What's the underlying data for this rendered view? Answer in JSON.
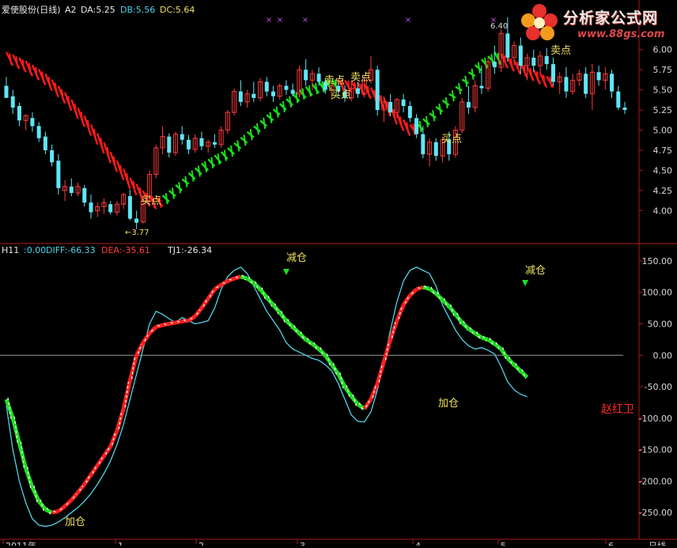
{
  "top_panel": {
    "name": "爱使股份(日线)",
    "tag": "A2",
    "readouts": [
      {
        "text": "DA:5.25",
        "color": "#e8e8e8"
      },
      {
        "text": "DB:5.56",
        "color": "#4fd4e8"
      },
      {
        "text": "DC:5.64",
        "color": "#f0e060"
      }
    ]
  },
  "bottom_panel": {
    "name": "H11",
    "readouts": [
      {
        "text": ":0.00",
        "color": "#4fd4e8"
      },
      {
        "text": "DIFF:-66.33",
        "color": "#4fd4e8"
      },
      {
        "text": "DEA:-35.61",
        "color": "#ff4040"
      },
      {
        "text": "TJ1:-26.34",
        "color": "#e8e8e8"
      }
    ]
  },
  "logo": {
    "title": "分析家公式网",
    "url": "www.88gs.com"
  },
  "x_axis": {
    "labels": [
      "2011年",
      "1",
      "2",
      "3",
      "4",
      "5",
      "6"
    ],
    "right_label": "日线"
  },
  "colors": {
    "up_candle": "#ff3b3b",
    "down_candle": "#5fe6f6",
    "ribbon_up": "#18e018",
    "ribbon_down": "#ff1a1a",
    "diff_line": "#4fd4e8",
    "dea_line": "#ff2020",
    "axis": "#b01818",
    "label": "#f0e060"
  },
  "chart_data": [
    {
      "type": "candlestick",
      "y_axis": {
        "ticks": [
          4.0,
          4.25,
          4.5,
          4.75,
          5.0,
          5.25,
          5.5,
          5.75,
          6.0
        ],
        "ylim": [
          3.65,
          6.4
        ]
      },
      "annotations": [
        {
          "text": "←3.77",
          "kind": "low_marker",
          "value": 3.77
        },
        {
          "text": "6.40",
          "kind": "high_marker",
          "value": 6.4
        },
        {
          "text": "买点",
          "kind": "buy"
        },
        {
          "text": "卖点",
          "kind": "sell"
        },
        {
          "text": "卖点",
          "kind": "sell"
        },
        {
          "text": "买点",
          "kind": "buy"
        },
        {
          "text": "买点",
          "kind": "buy"
        },
        {
          "text": "卖点",
          "kind": "sell"
        }
      ],
      "markers": [
        "×",
        "×",
        "×",
        "×",
        "×"
      ],
      "ribbon_values": [
        5.9,
        5.87,
        5.83,
        5.79,
        5.74,
        5.69,
        5.63,
        5.56,
        5.48,
        5.4,
        5.31,
        5.21,
        5.11,
        5.0,
        4.89,
        4.78,
        4.66,
        4.55,
        4.45,
        4.34,
        4.26,
        4.18,
        4.12,
        4.09,
        4.12,
        4.18,
        4.25,
        4.32,
        4.4,
        4.46,
        4.52,
        4.57,
        4.62,
        4.66,
        4.71,
        4.77,
        4.84,
        4.91,
        4.98,
        5.05,
        5.12,
        5.19,
        5.26,
        5.32,
        5.38,
        5.43,
        5.47,
        5.5,
        5.53,
        5.55,
        5.56,
        5.56,
        5.55,
        5.54,
        5.52,
        5.5,
        5.46,
        5.4,
        5.33,
        5.24,
        5.14,
        5.06,
        5.0,
        5.02,
        5.07,
        5.14,
        5.22,
        5.3,
        5.38,
        5.47,
        5.56,
        5.65,
        5.74,
        5.81,
        5.85,
        5.9,
        5.88,
        5.84,
        5.8,
        5.76,
        5.72,
        5.68,
        5.64,
        5.6
      ],
      "ribbon_states": [
        "down",
        "down",
        "down",
        "down",
        "down",
        "down",
        "down",
        "down",
        "down",
        "down",
        "down",
        "down",
        "down",
        "down",
        "down",
        "down",
        "down",
        "down",
        "down",
        "down",
        "down",
        "down",
        "down",
        "down",
        "up",
        "up",
        "up",
        "up",
        "up",
        "up",
        "up",
        "up",
        "up",
        "up",
        "up",
        "up",
        "up",
        "up",
        "up",
        "up",
        "up",
        "up",
        "up",
        "up",
        "up",
        "up",
        "up",
        "up",
        "up",
        "up",
        "up",
        "down",
        "down",
        "down",
        "down",
        "down",
        "down",
        "down",
        "down",
        "down",
        "down",
        "down",
        "down",
        "up",
        "up",
        "up",
        "up",
        "up",
        "up",
        "up",
        "up",
        "up",
        "up",
        "up",
        "up",
        "up",
        "down",
        "down",
        "down",
        "down",
        "down",
        "down",
        "down",
        "down"
      ],
      "candles": [
        {
          "o": 5.55,
          "h": 5.66,
          "l": 5.45,
          "c": 5.4
        },
        {
          "o": 5.42,
          "h": 5.5,
          "l": 5.2,
          "c": 5.28
        },
        {
          "o": 5.3,
          "h": 5.34,
          "l": 5.05,
          "c": 5.12
        },
        {
          "o": 5.12,
          "h": 5.2,
          "l": 5.0,
          "c": 5.18
        },
        {
          "o": 5.15,
          "h": 5.22,
          "l": 4.98,
          "c": 5.05
        },
        {
          "o": 5.05,
          "h": 5.1,
          "l": 4.85,
          "c": 4.9
        },
        {
          "o": 4.92,
          "h": 4.98,
          "l": 4.7,
          "c": 4.75
        },
        {
          "o": 4.75,
          "h": 4.82,
          "l": 4.55,
          "c": 4.6
        },
        {
          "o": 4.62,
          "h": 4.7,
          "l": 4.2,
          "c": 4.28
        },
        {
          "o": 4.25,
          "h": 4.38,
          "l": 4.12,
          "c": 4.3
        },
        {
          "o": 4.3,
          "h": 4.4,
          "l": 4.18,
          "c": 4.22
        },
        {
          "o": 4.22,
          "h": 4.35,
          "l": 4.18,
          "c": 4.3
        },
        {
          "o": 4.28,
          "h": 4.32,
          "l": 4.05,
          "c": 4.1
        },
        {
          "o": 4.1,
          "h": 4.2,
          "l": 3.9,
          "c": 3.98
        },
        {
          "o": 4.0,
          "h": 4.1,
          "l": 3.92,
          "c": 4.05
        },
        {
          "o": 4.05,
          "h": 4.15,
          "l": 3.96,
          "c": 4.1
        },
        {
          "o": 4.08,
          "h": 4.12,
          "l": 3.95,
          "c": 3.98
        },
        {
          "o": 3.98,
          "h": 4.12,
          "l": 3.94,
          "c": 4.08
        },
        {
          "o": 4.08,
          "h": 4.22,
          "l": 4.02,
          "c": 4.2
        },
        {
          "o": 4.18,
          "h": 4.26,
          "l": 3.88,
          "c": 3.9
        },
        {
          "o": 3.9,
          "h": 4.0,
          "l": 3.77,
          "c": 3.85
        },
        {
          "o": 3.86,
          "h": 4.18,
          "l": 3.84,
          "c": 4.12
        },
        {
          "o": 4.12,
          "h": 4.5,
          "l": 4.1,
          "c": 4.45
        },
        {
          "o": 4.45,
          "h": 4.82,
          "l": 4.4,
          "c": 4.78
        },
        {
          "o": 4.78,
          "h": 5.05,
          "l": 4.7,
          "c": 4.92
        },
        {
          "o": 4.92,
          "h": 4.96,
          "l": 4.66,
          "c": 4.72
        },
        {
          "o": 4.72,
          "h": 4.98,
          "l": 4.68,
          "c": 4.95
        },
        {
          "o": 4.95,
          "h": 5.05,
          "l": 4.82,
          "c": 4.88
        },
        {
          "o": 4.88,
          "h": 4.94,
          "l": 4.7,
          "c": 4.76
        },
        {
          "o": 4.76,
          "h": 4.95,
          "l": 4.72,
          "c": 4.9
        },
        {
          "o": 4.9,
          "h": 4.98,
          "l": 4.75,
          "c": 4.8
        },
        {
          "o": 4.8,
          "h": 4.88,
          "l": 4.72,
          "c": 4.85
        },
        {
          "o": 4.85,
          "h": 4.95,
          "l": 4.78,
          "c": 4.82
        },
        {
          "o": 4.82,
          "h": 5.05,
          "l": 4.78,
          "c": 5.0
        },
        {
          "o": 5.0,
          "h": 5.25,
          "l": 4.95,
          "c": 5.22
        },
        {
          "o": 5.22,
          "h": 5.52,
          "l": 5.18,
          "c": 5.48
        },
        {
          "o": 5.48,
          "h": 5.62,
          "l": 5.3,
          "c": 5.35
        },
        {
          "o": 5.35,
          "h": 5.5,
          "l": 5.28,
          "c": 5.45
        },
        {
          "o": 5.45,
          "h": 5.6,
          "l": 5.35,
          "c": 5.4
        },
        {
          "o": 5.4,
          "h": 5.65,
          "l": 5.36,
          "c": 5.6
        },
        {
          "o": 5.6,
          "h": 5.66,
          "l": 5.42,
          "c": 5.48
        },
        {
          "o": 5.48,
          "h": 5.55,
          "l": 5.35,
          "c": 5.42
        },
        {
          "o": 5.42,
          "h": 5.58,
          "l": 5.38,
          "c": 5.55
        },
        {
          "o": 5.55,
          "h": 5.62,
          "l": 5.44,
          "c": 5.5
        },
        {
          "o": 5.5,
          "h": 5.58,
          "l": 5.42,
          "c": 5.45
        },
        {
          "o": 5.45,
          "h": 5.8,
          "l": 5.4,
          "c": 5.75
        },
        {
          "o": 5.75,
          "h": 5.88,
          "l": 5.55,
          "c": 5.62
        },
        {
          "o": 5.62,
          "h": 5.75,
          "l": 5.5,
          "c": 5.7
        },
        {
          "o": 5.7,
          "h": 5.78,
          "l": 5.55,
          "c": 5.6
        },
        {
          "o": 5.6,
          "h": 5.65,
          "l": 5.45,
          "c": 5.5
        },
        {
          "o": 5.5,
          "h": 5.6,
          "l": 5.38,
          "c": 5.55
        },
        {
          "o": 5.55,
          "h": 5.62,
          "l": 5.42,
          "c": 5.48
        },
        {
          "o": 5.48,
          "h": 5.56,
          "l": 5.35,
          "c": 5.4
        },
        {
          "o": 5.4,
          "h": 5.58,
          "l": 5.36,
          "c": 5.52
        },
        {
          "o": 5.52,
          "h": 5.6,
          "l": 5.4,
          "c": 5.45
        },
        {
          "o": 5.45,
          "h": 5.68,
          "l": 5.4,
          "c": 5.62
        },
        {
          "o": 5.62,
          "h": 5.92,
          "l": 5.58,
          "c": 5.75
        },
        {
          "o": 5.75,
          "h": 5.8,
          "l": 5.18,
          "c": 5.25
        },
        {
          "o": 5.25,
          "h": 5.42,
          "l": 5.1,
          "c": 5.35
        },
        {
          "o": 5.35,
          "h": 5.45,
          "l": 5.18,
          "c": 5.22
        },
        {
          "o": 5.22,
          "h": 5.4,
          "l": 5.15,
          "c": 5.38
        },
        {
          "o": 5.38,
          "h": 5.45,
          "l": 5.22,
          "c": 5.3
        },
        {
          "o": 5.3,
          "h": 5.36,
          "l": 5.1,
          "c": 5.15
        },
        {
          "o": 5.15,
          "h": 5.2,
          "l": 4.9,
          "c": 4.95
        },
        {
          "o": 4.95,
          "h": 5.05,
          "l": 4.65,
          "c": 4.7
        },
        {
          "o": 4.7,
          "h": 4.9,
          "l": 4.55,
          "c": 4.85
        },
        {
          "o": 4.85,
          "h": 4.9,
          "l": 4.62,
          "c": 4.68
        },
        {
          "o": 4.68,
          "h": 4.92,
          "l": 4.6,
          "c": 4.88
        },
        {
          "o": 4.88,
          "h": 4.98,
          "l": 4.62,
          "c": 4.7
        },
        {
          "o": 4.7,
          "h": 5.05,
          "l": 4.66,
          "c": 5.0
        },
        {
          "o": 5.0,
          "h": 5.4,
          "l": 4.96,
          "c": 5.35
        },
        {
          "o": 5.35,
          "h": 5.55,
          "l": 5.2,
          "c": 5.28
        },
        {
          "o": 5.28,
          "h": 5.62,
          "l": 5.22,
          "c": 5.55
        },
        {
          "o": 5.55,
          "h": 5.8,
          "l": 5.45,
          "c": 5.52
        },
        {
          "o": 5.52,
          "h": 5.9,
          "l": 5.48,
          "c": 5.85
        },
        {
          "o": 5.85,
          "h": 6.05,
          "l": 5.7,
          "c": 5.78
        },
        {
          "o": 5.78,
          "h": 6.25,
          "l": 5.72,
          "c": 6.2
        },
        {
          "o": 6.2,
          "h": 6.4,
          "l": 5.85,
          "c": 5.9
        },
        {
          "o": 5.9,
          "h": 6.1,
          "l": 5.8,
          "c": 6.05
        },
        {
          "o": 6.05,
          "h": 6.15,
          "l": 5.7,
          "c": 5.8
        },
        {
          "o": 5.8,
          "h": 5.95,
          "l": 5.62,
          "c": 5.9
        },
        {
          "o": 5.9,
          "h": 6.0,
          "l": 5.72,
          "c": 5.8
        },
        {
          "o": 5.8,
          "h": 5.98,
          "l": 5.7,
          "c": 5.92
        },
        {
          "o": 5.92,
          "h": 6.02,
          "l": 5.75,
          "c": 5.82
        },
        {
          "o": 5.82,
          "h": 5.9,
          "l": 5.55,
          "c": 5.6
        },
        {
          "o": 5.6,
          "h": 5.72,
          "l": 5.45,
          "c": 5.66
        },
        {
          "o": 5.66,
          "h": 5.78,
          "l": 5.4,
          "c": 5.48
        },
        {
          "o": 5.48,
          "h": 5.7,
          "l": 5.44,
          "c": 5.62
        },
        {
          "o": 5.62,
          "h": 5.75,
          "l": 5.55,
          "c": 5.7
        },
        {
          "o": 5.7,
          "h": 5.78,
          "l": 5.4,
          "c": 5.45
        },
        {
          "o": 5.45,
          "h": 5.82,
          "l": 5.25,
          "c": 5.72
        },
        {
          "o": 5.72,
          "h": 5.8,
          "l": 5.55,
          "c": 5.62
        },
        {
          "o": 5.62,
          "h": 5.78,
          "l": 5.5,
          "c": 5.7
        },
        {
          "o": 5.7,
          "h": 5.75,
          "l": 5.4,
          "c": 5.48
        },
        {
          "o": 5.48,
          "h": 5.55,
          "l": 5.25,
          "c": 5.28
        },
        {
          "o": 5.28,
          "h": 5.35,
          "l": 5.2,
          "c": 5.25
        }
      ]
    },
    {
      "type": "line",
      "y_axis": {
        "ticks": [
          150.0,
          100.0,
          50.0,
          0.0,
          -50.0,
          -100.0,
          -150.0,
          -200.0,
          -250.0
        ],
        "ylim": [
          -290,
          165
        ]
      },
      "zero_line": true,
      "annotations": [
        {
          "text": "加仓",
          "kind": "add"
        },
        {
          "text": "减仓",
          "kind": "reduce"
        },
        {
          "text": "加仓",
          "kind": "add"
        },
        {
          "text": "减仓",
          "kind": "reduce"
        }
      ],
      "indicator_name": "赵红卫",
      "series": [
        {
          "name": "DIFF",
          "values": [
            -80,
            -150,
            -200,
            -235,
            -260,
            -270,
            -272,
            -270,
            -265,
            -258,
            -250,
            -242,
            -232,
            -220,
            -205,
            -188,
            -168,
            -142,
            -110,
            -70,
            -30,
            10,
            50,
            70,
            65,
            58,
            52,
            60,
            55,
            50,
            52,
            55,
            75,
            105,
            125,
            135,
            140,
            130,
            110,
            90,
            70,
            55,
            40,
            20,
            10,
            5,
            0,
            -5,
            -8,
            -15,
            -25,
            -45,
            -70,
            -95,
            -105,
            -106,
            -90,
            -55,
            -10,
            40,
            85,
            118,
            135,
            140,
            135,
            130,
            110,
            80,
            60,
            40,
            25,
            15,
            10,
            12,
            8,
            2,
            -18,
            -42,
            -55,
            -62,
            -66
          ]
        },
        {
          "name": "DEA",
          "values": [
            -70,
            -100,
            -140,
            -180,
            -210,
            -232,
            -245,
            -250,
            -248,
            -240,
            -230,
            -218,
            -205,
            -190,
            -175,
            -160,
            -145,
            -120,
            -85,
            -40,
            0,
            20,
            35,
            45,
            48,
            50,
            52,
            54,
            55,
            62,
            75,
            90,
            105,
            112,
            118,
            122,
            125,
            122,
            115,
            105,
            92,
            80,
            68,
            55,
            45,
            35,
            25,
            18,
            10,
            0,
            -15,
            -30,
            -50,
            -65,
            -78,
            -85,
            -70,
            -45,
            -10,
            25,
            55,
            80,
            95,
            105,
            108,
            106,
            98,
            88,
            78,
            65,
            52,
            42,
            35,
            28,
            25,
            18,
            10,
            -5,
            -15,
            -25,
            -35
          ]
        }
      ]
    }
  ]
}
